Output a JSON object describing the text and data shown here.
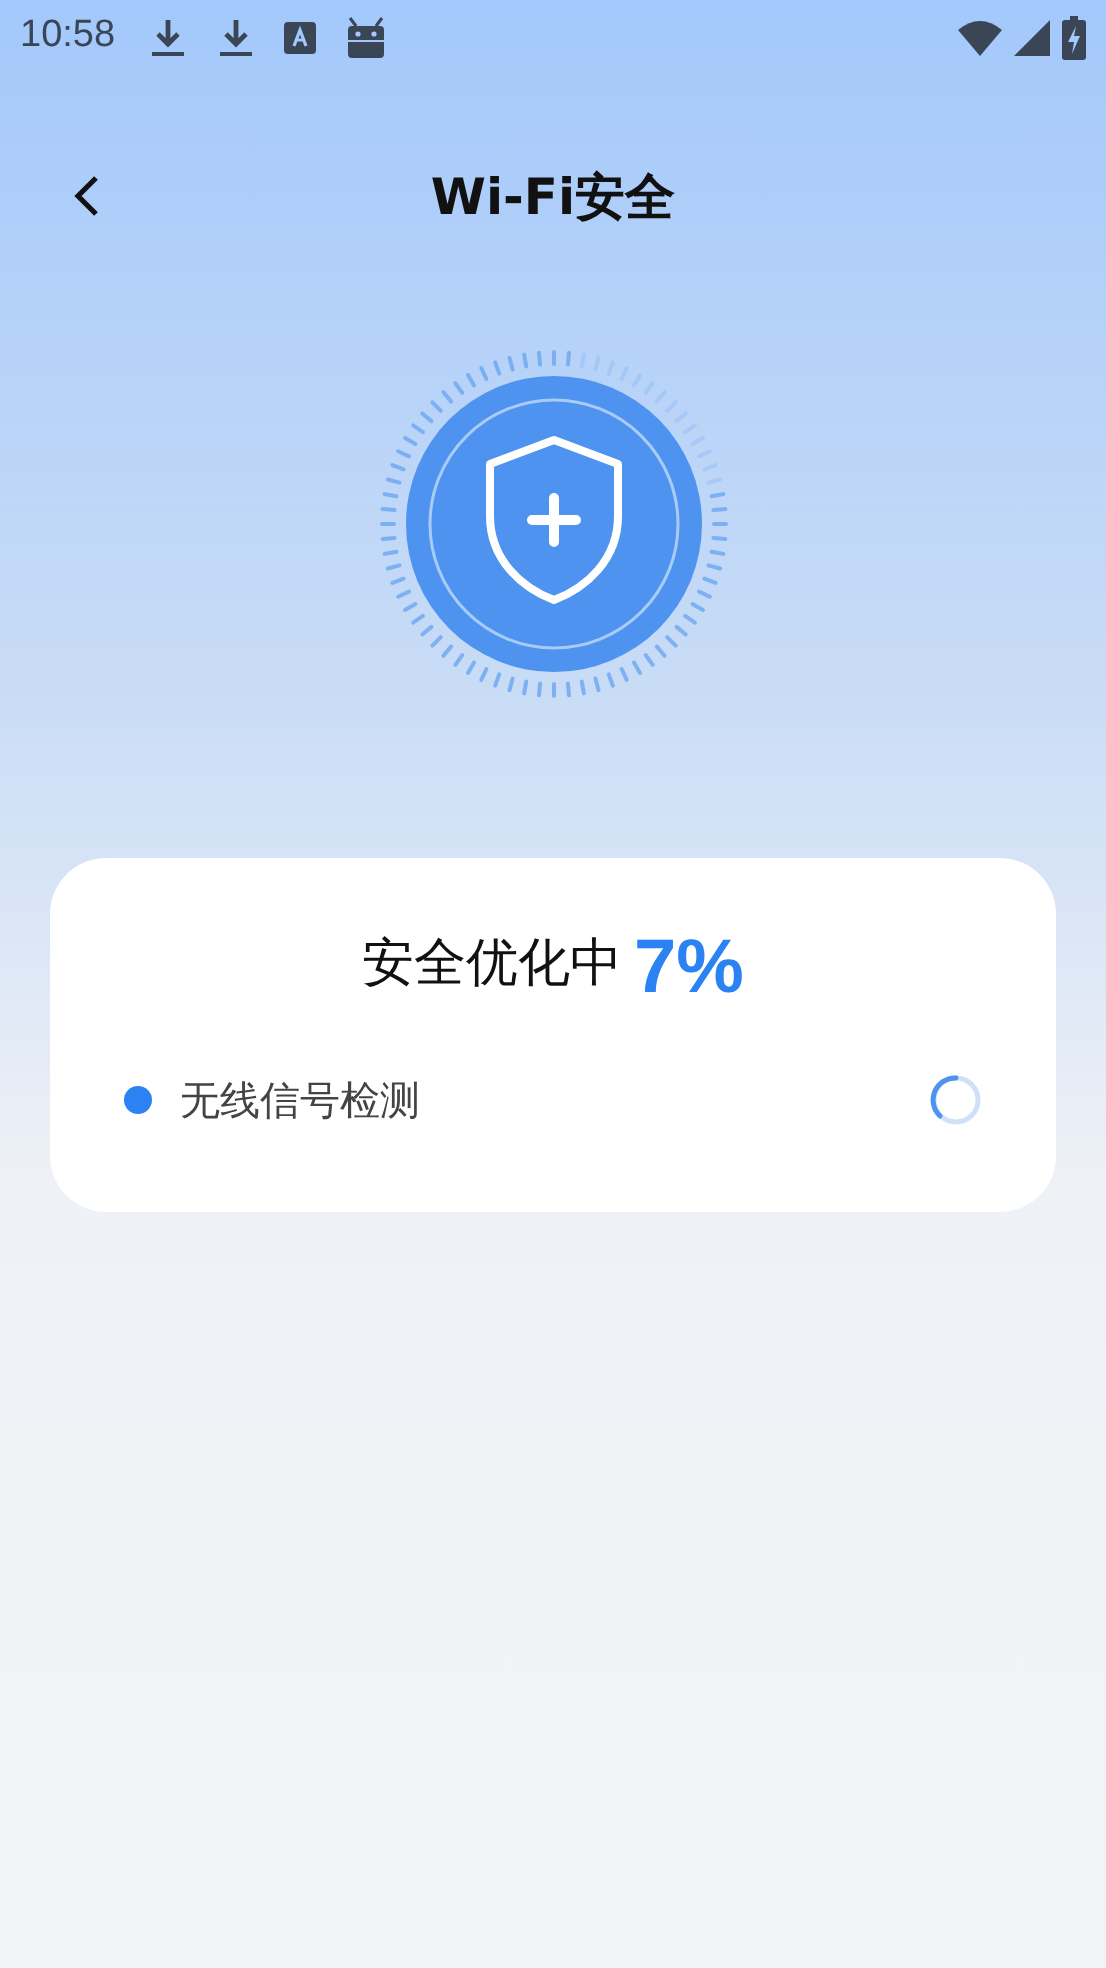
{
  "status_bar": {
    "time": "10:58"
  },
  "header": {
    "title": "Wi-Fi安全"
  },
  "progress": {
    "label": "安全优化中",
    "percent": "7%"
  },
  "checks": [
    {
      "label": "无线信号检测",
      "color": "#2b82f3",
      "kind": "running"
    }
  ]
}
